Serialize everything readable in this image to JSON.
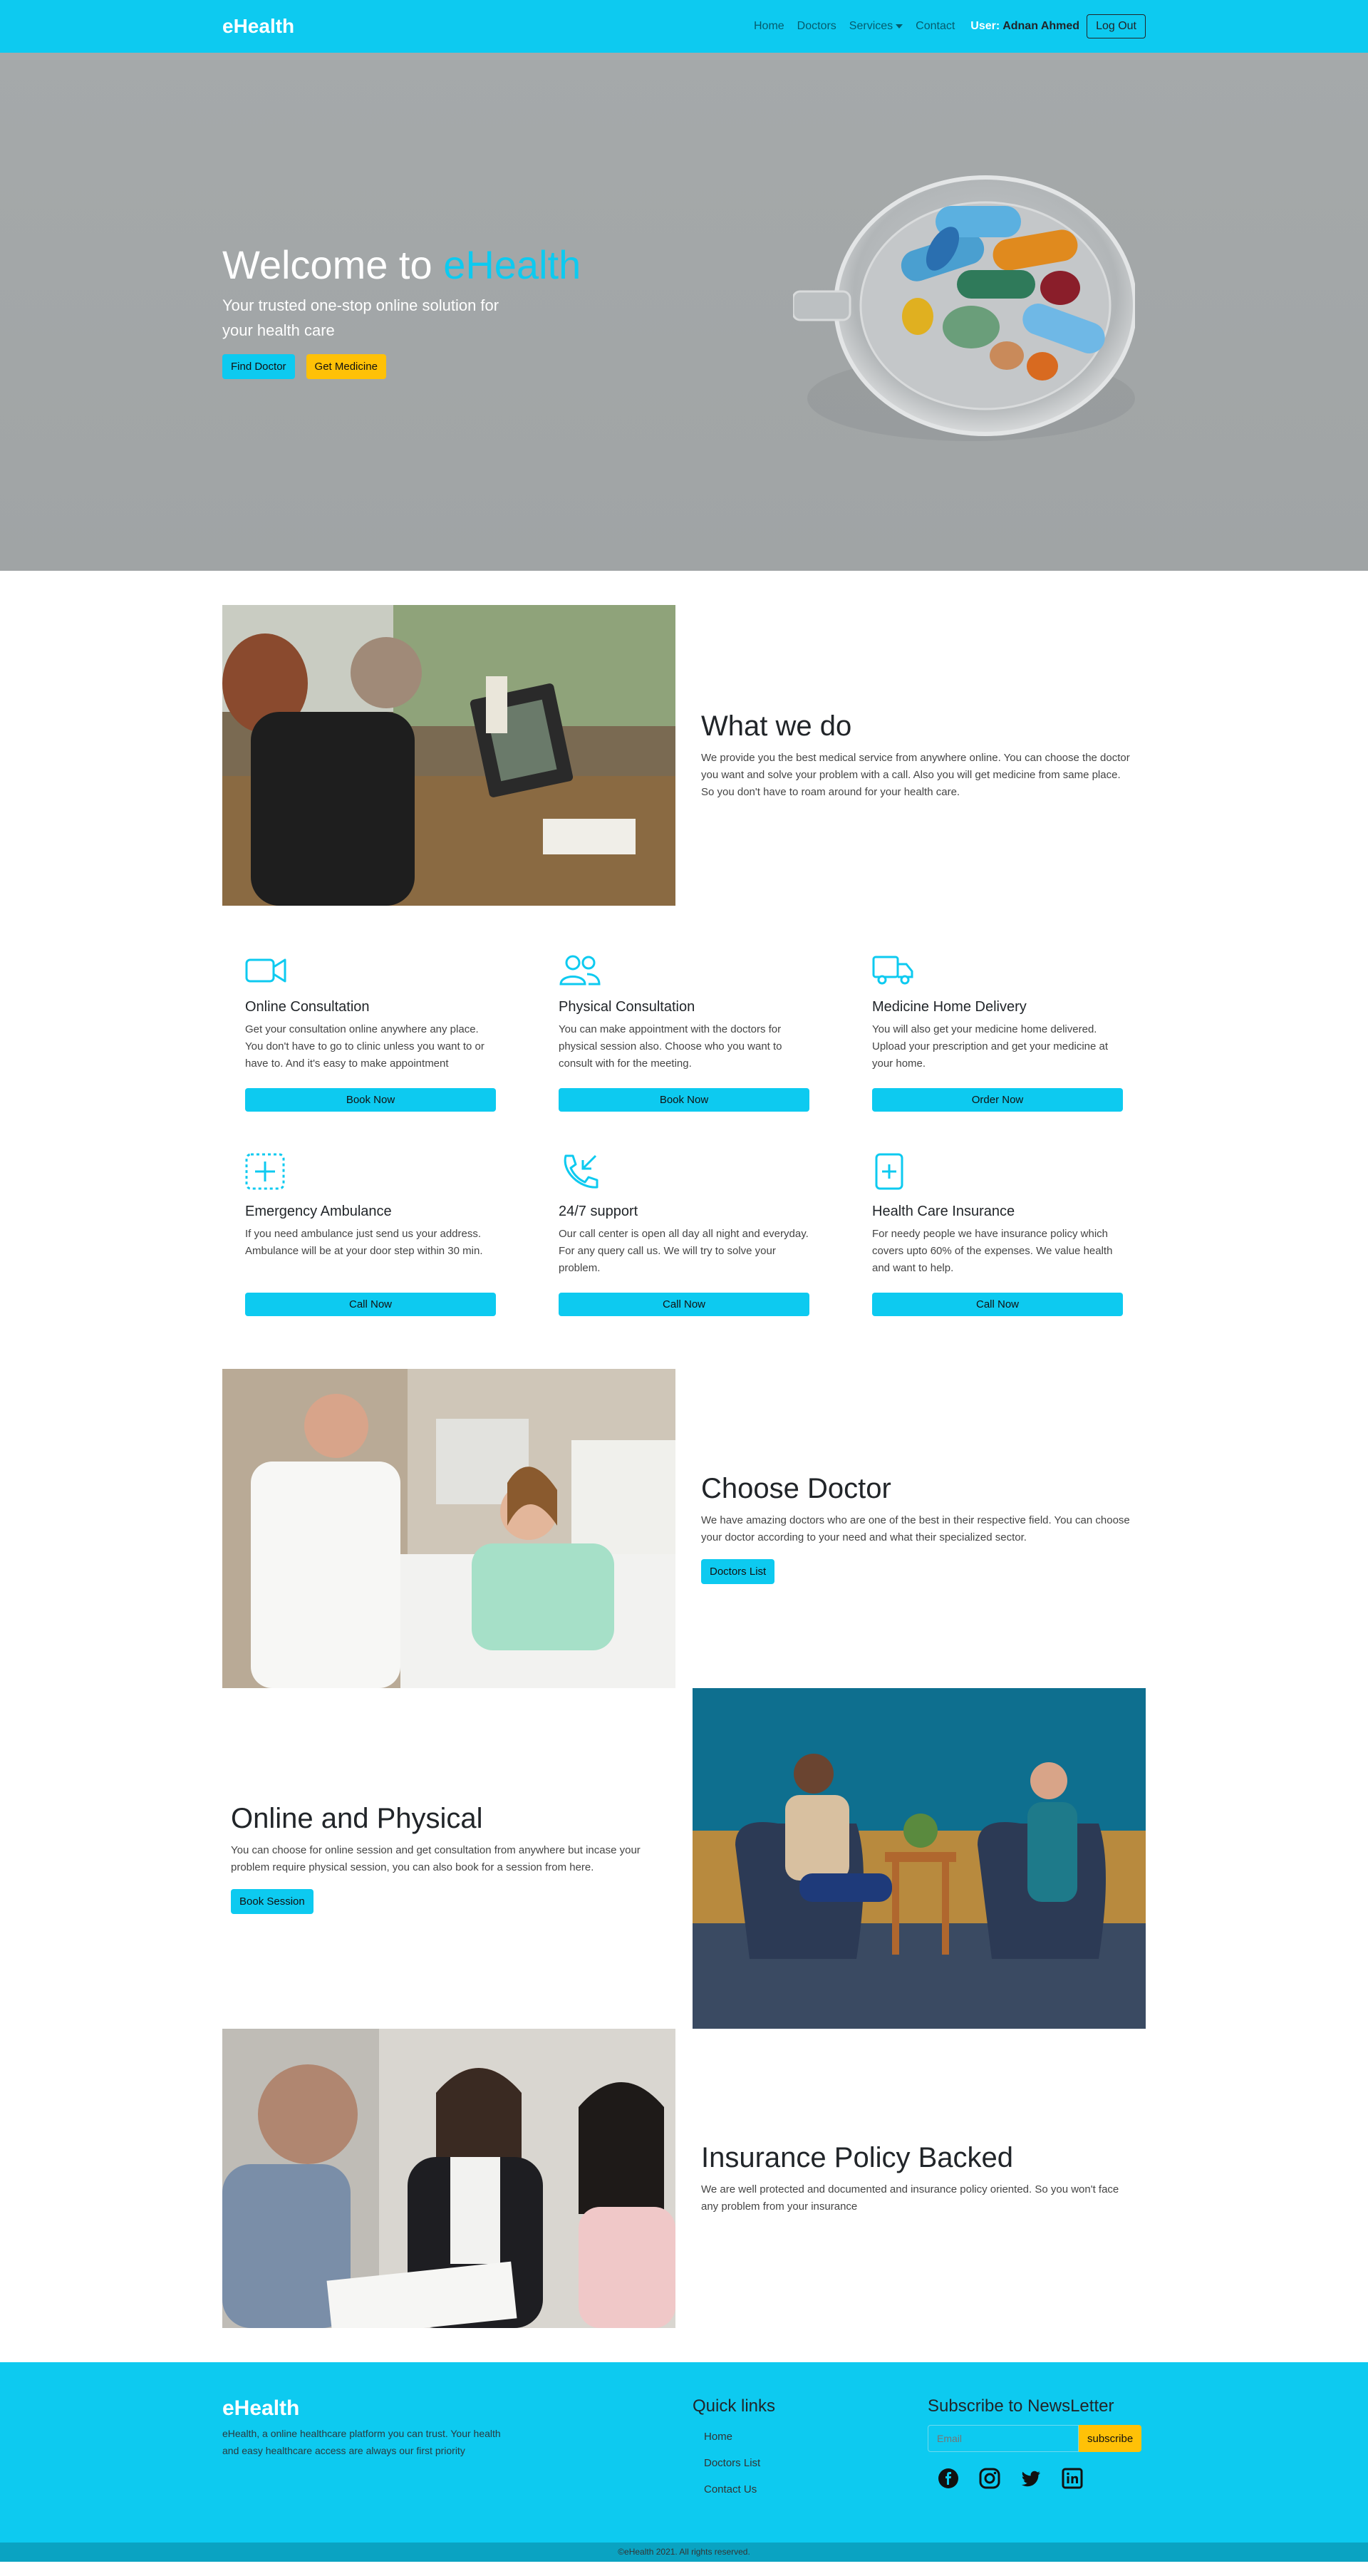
{
  "nav": {
    "brand": "eHealth",
    "links": [
      "Home",
      "Doctors",
      "Services",
      "Contact"
    ],
    "user_label": "User:",
    "user_name": "Adnan Ahmed",
    "logout": "Log Out"
  },
  "hero": {
    "title_prefix": "Welcome to ",
    "title_brand": "eHealth",
    "subtitle": "Your trusted one-stop online solution for your health care",
    "find_doctor": "Find Doctor",
    "get_medicine": "Get Medicine"
  },
  "what_we_do": {
    "title": "What we do",
    "text": "We provide you the best medical service from anywhere online. You can choose the doctor you want and solve your problem with a call. Also you will get medicine from same place. So you don't have to roam around for your health care."
  },
  "services": [
    {
      "icon": "video-camera-icon",
      "title": "Online Consultation",
      "text": "Get your consultation online anywhere any place. You don't have to go to clinic unless you want to or have to. And it's easy to make appointment",
      "button": "Book Now"
    },
    {
      "icon": "people-icon",
      "title": "Physical Consultation",
      "text": "You can make appointment with the doctors for physical session also. Choose who you want to consult with for the meeting.",
      "button": "Book Now"
    },
    {
      "icon": "truck-icon",
      "title": "Medicine Home Delivery",
      "text": "You will also get your medicine home delivered. Upload your prescription and get your medicine at your home.",
      "button": "Order Now"
    },
    {
      "icon": "plus-square-dotted-icon",
      "title": "Emergency Ambulance",
      "text": "If you need ambulance just send us your address. Ambulance will be at your door step within 30 min.",
      "button": "Call Now"
    },
    {
      "icon": "phone-incoming-icon",
      "title": "24/7 support",
      "text": "Our call center is open all day all night and everyday. For any query call us. We will try to solve your problem.",
      "button": "Call Now"
    },
    {
      "icon": "file-medical-icon",
      "title": "Health Care Insurance",
      "text": "For needy people we have insurance policy which covers upto 60% of the expenses. We value health and want to help.",
      "button": "Call Now"
    }
  ],
  "choose_doctor": {
    "title": "Choose Doctor",
    "text": "We have amazing doctors who are one of the best in their respective field. You can choose your doctor according to your need and what their specialized sector.",
    "button": "Doctors List"
  },
  "online_physical": {
    "title": "Online and Physical",
    "text": "You can choose for online session and get consultation from anywhere but incase your problem require physical session, you can also book for a session from here.",
    "button": "Book Session"
  },
  "insurance": {
    "title": "Insurance Policy Backed",
    "text": "We are well protected and documented and insurance policy oriented. So you won't face any problem from your insurance"
  },
  "footer": {
    "brand": "eHealth",
    "about": "eHealth, a online healthcare platform you can trust. Your health and easy healthcare access are always our first priority",
    "quick_links_title": "Quick links",
    "quick_links": [
      "Home",
      "Doctors List",
      "Contact Us"
    ],
    "subscribe_title": "Subscribe to NewsLetter",
    "email_placeholder": "Email",
    "subscribe_button": "subscribe",
    "socials": [
      "facebook-icon",
      "instagram-icon",
      "twitter-icon",
      "linkedin-icon"
    ],
    "copyright": "©eHealth 2021. All rights reserved."
  },
  "colors": {
    "primary": "#0dcaf0",
    "warning": "#ffc107",
    "footer_bottom": "#0aa3c2"
  }
}
